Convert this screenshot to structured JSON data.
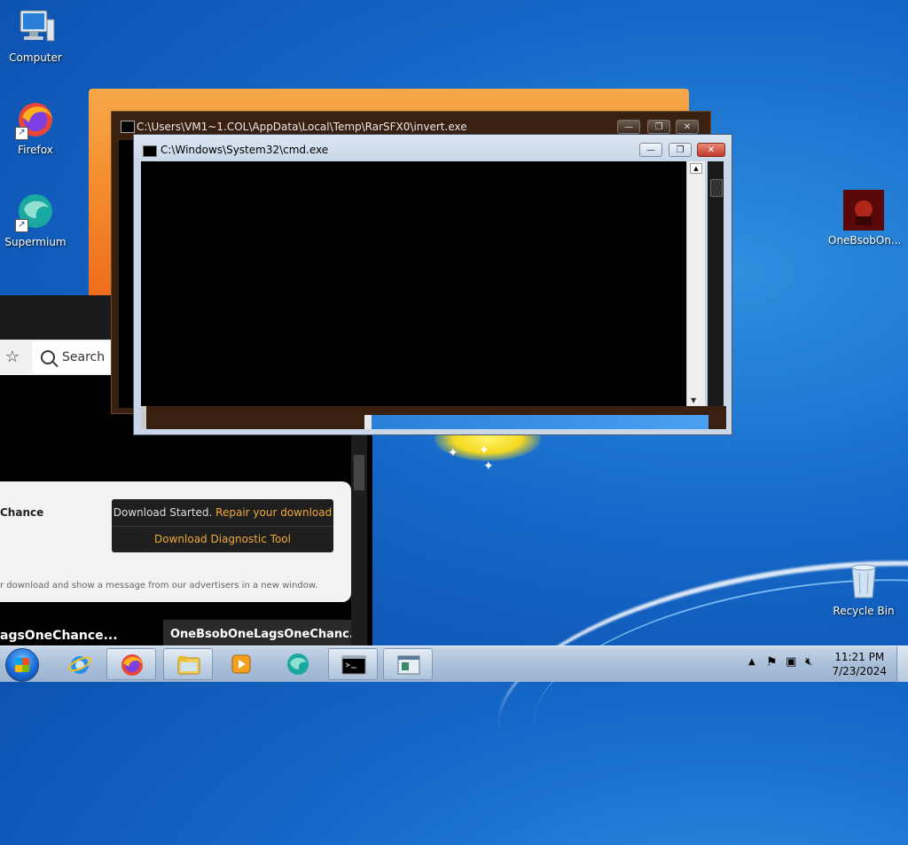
{
  "desktop": {
    "icons": [
      {
        "label": "Computer",
        "icon": "computer-icon"
      },
      {
        "label": "Firefox",
        "icon": "firefox-icon"
      },
      {
        "label": "Supermium",
        "icon": "supermium-icon"
      },
      {
        "label": "OneBsobOn...",
        "icon": "app-file-icon"
      },
      {
        "label": "Recycle Bin",
        "icon": "recycle-bin-icon"
      }
    ]
  },
  "browser": {
    "search_label": "Search",
    "download_name": "Chance",
    "download_status_prefix": "Download Started.",
    "download_repair_link": "Repair your download",
    "download_diag_link": "Download Diagnostic Tool",
    "download_note": "r download and show a message from our advertisers in a new window.",
    "tab1_label": "agsOneChance...",
    "tab2_label": "OneBsobOneLagsOneChanc..."
  },
  "windows": {
    "back_title": "C:\\Users\\VM1~1.COL\\AppData\\Local\\Temp\\RarSFX0\\invert.exe",
    "front_title": "C:\\Windows\\System32\\cmd.exe",
    "minimize": "—",
    "maximize": "❐",
    "close": "✕"
  },
  "taskbar": {
    "items": [
      {
        "name": "internet-explorer",
        "active": false
      },
      {
        "name": "firefox",
        "active": true
      },
      {
        "name": "file-explorer",
        "active": true
      },
      {
        "name": "media-player",
        "active": false
      },
      {
        "name": "supermium",
        "active": false
      },
      {
        "name": "cmd",
        "active": true
      },
      {
        "name": "invert-app",
        "active": true
      }
    ],
    "clock_time": "11:21 PM",
    "clock_date": "7/23/2024"
  },
  "colors": {
    "accent_orange": "#f0a83a",
    "desktop_blue": "#1568c8"
  }
}
